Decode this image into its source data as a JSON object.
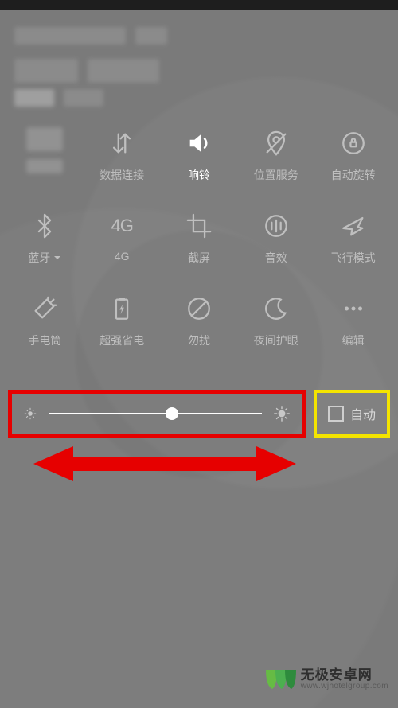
{
  "tiles": {
    "row1": {
      "wifi": {
        "label": ""
      },
      "data": {
        "label": "数据连接"
      },
      "ring": {
        "label": "响铃"
      },
      "location": {
        "label": "位置服务"
      },
      "rotate": {
        "label": "自动旋转"
      }
    },
    "row2": {
      "bluetooth": {
        "label": "蓝牙"
      },
      "fourg": {
        "label": "4G",
        "icon_text": "4G"
      },
      "screenshot": {
        "label": "截屏"
      },
      "sound_effect": {
        "label": "音效"
      },
      "airplane": {
        "label": "飞行模式"
      }
    },
    "row3": {
      "flashlight": {
        "label": "手电筒"
      },
      "ultra_save": {
        "label": "超强省电"
      },
      "dnd": {
        "label": "勿扰"
      },
      "night": {
        "label": "夜间护眼"
      },
      "edit": {
        "label": "编辑"
      }
    }
  },
  "brightness": {
    "slider_percent": 58,
    "auto_label": "自动",
    "auto_checked": false
  },
  "annotations": {
    "slider_highlight_color": "#e60000",
    "auto_highlight_color": "#f4e400",
    "arrow_color": "#e60000"
  },
  "watermark": {
    "cn": "无极安卓网",
    "url": "www.wjhotelgroup.com"
  }
}
